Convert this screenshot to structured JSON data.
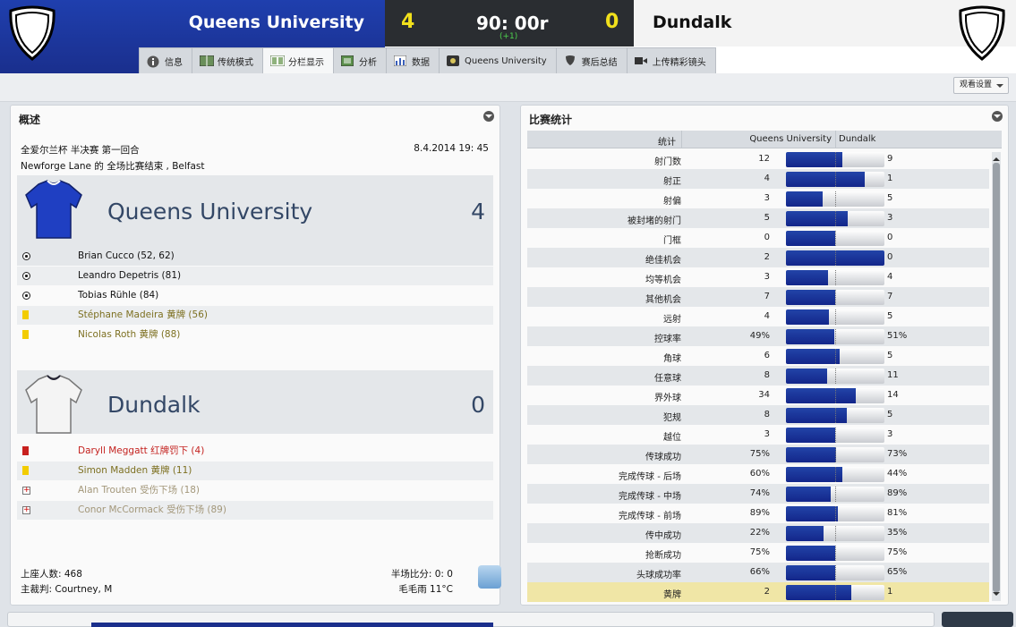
{
  "header": {
    "home_team": "Queens University",
    "away_team": "Dundalk",
    "home_score": "4",
    "away_score": "0",
    "clock": "90: 00r",
    "stoppage": "(+1)"
  },
  "tabs": [
    {
      "label": "信息",
      "icon": "info-icon"
    },
    {
      "label": "传统模式",
      "icon": "pitch-icon"
    },
    {
      "label": "分栏显示",
      "icon": "split-view-icon"
    },
    {
      "label": "分析",
      "icon": "analysis-icon"
    },
    {
      "label": "数据",
      "icon": "data-chart-icon"
    },
    {
      "label": "Queens University",
      "icon": "club-badge-icon"
    },
    {
      "label": "赛后总结",
      "icon": "shield-icon"
    },
    {
      "label": "上传精彩镜头",
      "icon": "video-camera-icon"
    }
  ],
  "view_settings": "观看设置",
  "overview": {
    "title": "概述",
    "competition": "全爱尔兰杯 半决赛 第一回合",
    "datetime": "8.4.2014 19: 45",
    "venue": "Newforge Lane 的 全场比赛结束 , Belfast",
    "home": {
      "name": "Queens University",
      "score": "4",
      "events": [
        {
          "type": "goal",
          "text": "Brian Cucco (52, 62)"
        },
        {
          "type": "goal",
          "text": "Leandro Depetris (81)"
        },
        {
          "type": "goal",
          "text": "Tobias Rühle (84)"
        },
        {
          "type": "yellow",
          "text": "Stéphane Madeira 黄牌 (56)"
        },
        {
          "type": "yellow",
          "text": "Nicolas Roth 黄牌 (88)"
        }
      ]
    },
    "away": {
      "name": "Dundalk",
      "score": "0",
      "events": [
        {
          "type": "red",
          "text": "Daryll Meggatt 红牌罚下 (4)"
        },
        {
          "type": "yellow",
          "text": "Simon Madden 黄牌 (11)"
        },
        {
          "type": "injury",
          "text": "Alan Trouten 受伤下场 (18)"
        },
        {
          "type": "injury",
          "text": "Conor McCormack 受伤下场 (89)"
        }
      ]
    },
    "attendance": "上座人数: 468",
    "referee": "主裁判: Courtney, M",
    "halftime": "半场比分: 0: 0",
    "weather": "毛毛雨 11°C"
  },
  "stats": {
    "title": "比赛统计",
    "col_stat": "统计",
    "col_home": "Queens University",
    "col_away": "Dundalk",
    "rows": [
      {
        "label": "射门数",
        "home": "12",
        "away": "9",
        "ratio": 0.57
      },
      {
        "label": "射正",
        "home": "4",
        "away": "1",
        "ratio": 0.8
      },
      {
        "label": "射偏",
        "home": "3",
        "away": "5",
        "ratio": 0.375
      },
      {
        "label": "被封堵的射门",
        "home": "5",
        "away": "3",
        "ratio": 0.625
      },
      {
        "label": "门框",
        "home": "0",
        "away": "0",
        "ratio": 0.5
      },
      {
        "label": "绝佳机会",
        "home": "2",
        "away": "0",
        "ratio": 1.0
      },
      {
        "label": "均等机会",
        "home": "3",
        "away": "4",
        "ratio": 0.43
      },
      {
        "label": "其他机会",
        "home": "7",
        "away": "7",
        "ratio": 0.5
      },
      {
        "label": "远射",
        "home": "4",
        "away": "5",
        "ratio": 0.44
      },
      {
        "label": "控球率",
        "home": "49%",
        "away": "51%",
        "ratio": 0.49
      },
      {
        "label": "角球",
        "home": "6",
        "away": "5",
        "ratio": 0.545
      },
      {
        "label": "任意球",
        "home": "8",
        "away": "11",
        "ratio": 0.42
      },
      {
        "label": "界外球",
        "home": "34",
        "away": "14",
        "ratio": 0.71
      },
      {
        "label": "犯规",
        "home": "8",
        "away": "5",
        "ratio": 0.615
      },
      {
        "label": "越位",
        "home": "3",
        "away": "3",
        "ratio": 0.5
      },
      {
        "label": "传球成功",
        "home": "75%",
        "away": "73%",
        "ratio": 0.505
      },
      {
        "label": "完成传球 - 后场",
        "home": "60%",
        "away": "44%",
        "ratio": 0.577
      },
      {
        "label": "完成传球 - 中场",
        "home": "74%",
        "away": "89%",
        "ratio": 0.454
      },
      {
        "label": "完成传球 - 前场",
        "home": "89%",
        "away": "81%",
        "ratio": 0.524
      },
      {
        "label": "传中成功",
        "home": "22%",
        "away": "35%",
        "ratio": 0.386
      },
      {
        "label": "抢断成功",
        "home": "75%",
        "away": "75%",
        "ratio": 0.5
      },
      {
        "label": "头球成功率",
        "home": "66%",
        "away": "65%",
        "ratio": 0.504
      },
      {
        "label": "黄牌",
        "home": "2",
        "away": "1",
        "ratio": 0.667
      }
    ]
  }
}
